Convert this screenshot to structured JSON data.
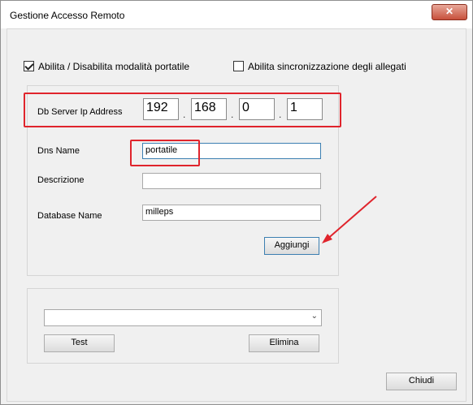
{
  "window": {
    "title": "Gestione Accesso Remoto",
    "close_glyph": "✕"
  },
  "options": {
    "portable_label": "Abilita / Disabilita modalità portatile",
    "portable_checked": true,
    "sync_label": "Abilita sincronizzazione degli allegati",
    "sync_checked": false
  },
  "server": {
    "ip_label": "Db Server Ip Address",
    "ip_octets": [
      "192",
      "168",
      "0",
      "1"
    ],
    "dot": "."
  },
  "form": {
    "dns_label": "Dns Name",
    "dns_value": "portatile",
    "description_label": "Descrizione",
    "description_value": "",
    "database_label": "Database Name",
    "database_value": "milleps",
    "add_button": "Aggiungi"
  },
  "list": {
    "selected_value": "",
    "test_button": "Test",
    "delete_button": "Elimina"
  },
  "footer": {
    "close_button": "Chiudi"
  },
  "annotations": {
    "highlight_color": "#e0242c"
  },
  "icons": {
    "combo_arrow": "chevron-down-icon",
    "close": "close-icon",
    "annotation": "arrow-annotation"
  }
}
